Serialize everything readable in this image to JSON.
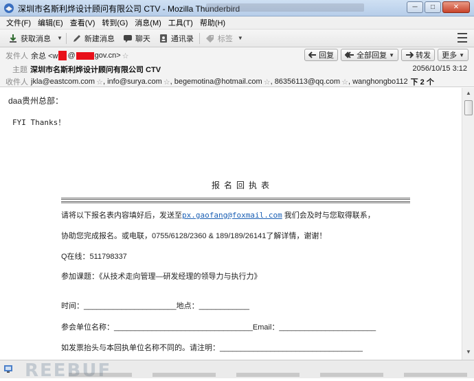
{
  "window": {
    "title": "深圳市名斯利烨设计顾问有限公司 CTV - Mozilla Thunderbird",
    "min_label": "─",
    "max_label": "□",
    "close_label": "✕"
  },
  "menu": [
    "文件(F)",
    "编辑(E)",
    "查看(V)",
    "转到(G)",
    "消息(M)",
    "工具(T)",
    "帮助(H)"
  ],
  "toolbar": {
    "get_mail": "获取消息",
    "write": "新建消息",
    "chat": "聊天",
    "address_book": "通讯录",
    "tag": "标签"
  },
  "header": {
    "from_label": "发件人",
    "from_name": "余总 <w",
    "from_mid": "@",
    "from_domain": "gov.cn>",
    "subject_label": "主题",
    "subject": "深圳市名斯利烨设计顾问有限公司 CTV",
    "to_label": "收件人",
    "recipients": [
      "jkla@eastcom.com",
      "info@surya.com",
      "begemotina@hotmail.com",
      "86356113@qq.com",
      "wanghongbo112"
    ],
    "more_recipients": "下 2 个",
    "date": "2056/10/15 3:12",
    "actions": {
      "reply": "回复",
      "reply_all": "全部回复",
      "forward": "转发",
      "more": "更多"
    }
  },
  "body": {
    "greeting": "daa贵州总部：",
    "fyi": "FYI Thanks！",
    "form_title": "报名回执表",
    "line1_pre": "请将以下报名表内容填好后，发送至",
    "line1_link": "px.gaofang@foxmail.com",
    "line1_post": " 我们会及时与您取得联系，",
    "line2": "协助您完成报名。或电联，0755/6128/2360 & 189/189/26141了解详情，谢谢！",
    "line3": "Q在线：511798337",
    "line4": "参加课题：《从技术走向管理—研发经理的领导力与执行力》",
    "line5": "时间：______________________地点：____________",
    "line6": "参会单位名称：_________________________________Email：_______________________",
    "line7": "如发票抬头与本回执单位名称不同的。请注明：__________________________________"
  },
  "status": {
    "watermark": "REEBUF"
  },
  "colors": {
    "link": "#1a5fb4",
    "redaction": "#e8101a"
  }
}
